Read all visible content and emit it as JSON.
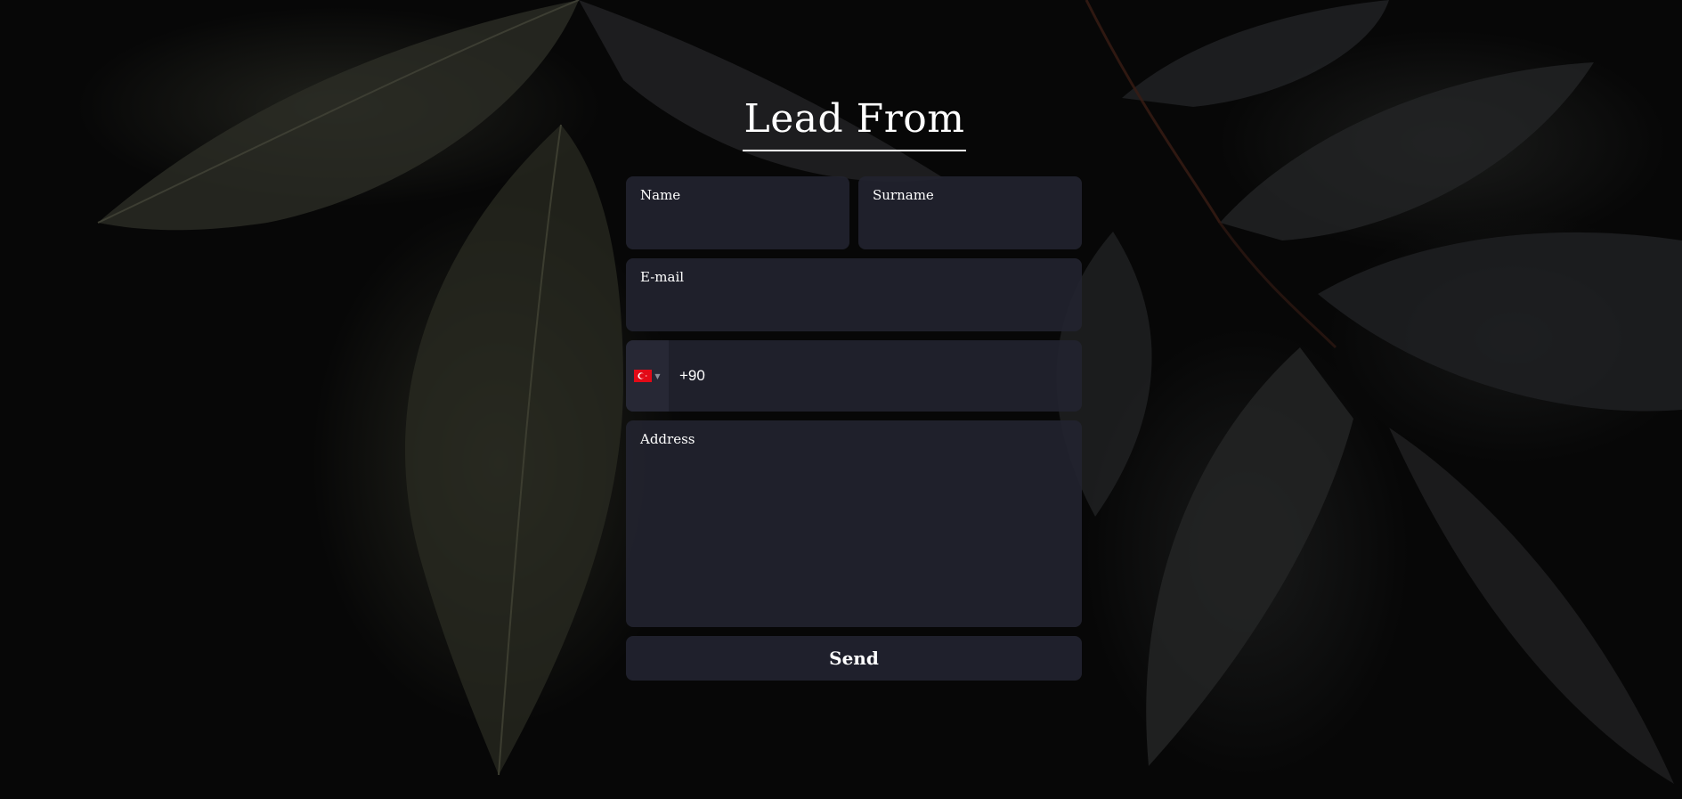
{
  "page": {
    "title": "Lead From"
  },
  "form": {
    "name": {
      "label": "Name",
      "value": ""
    },
    "surname": {
      "label": "Surname",
      "value": ""
    },
    "email": {
      "label": "E-mail",
      "value": ""
    },
    "phone": {
      "country_flag": "turkey-flag-icon",
      "dial_code": "+90",
      "value": ""
    },
    "address": {
      "label": "Address",
      "value": ""
    },
    "submit_label": "Send"
  },
  "colors": {
    "background": "#070707",
    "field_bg": "#21222e",
    "text": "#ffffff",
    "flag_red": "#e30a17"
  }
}
